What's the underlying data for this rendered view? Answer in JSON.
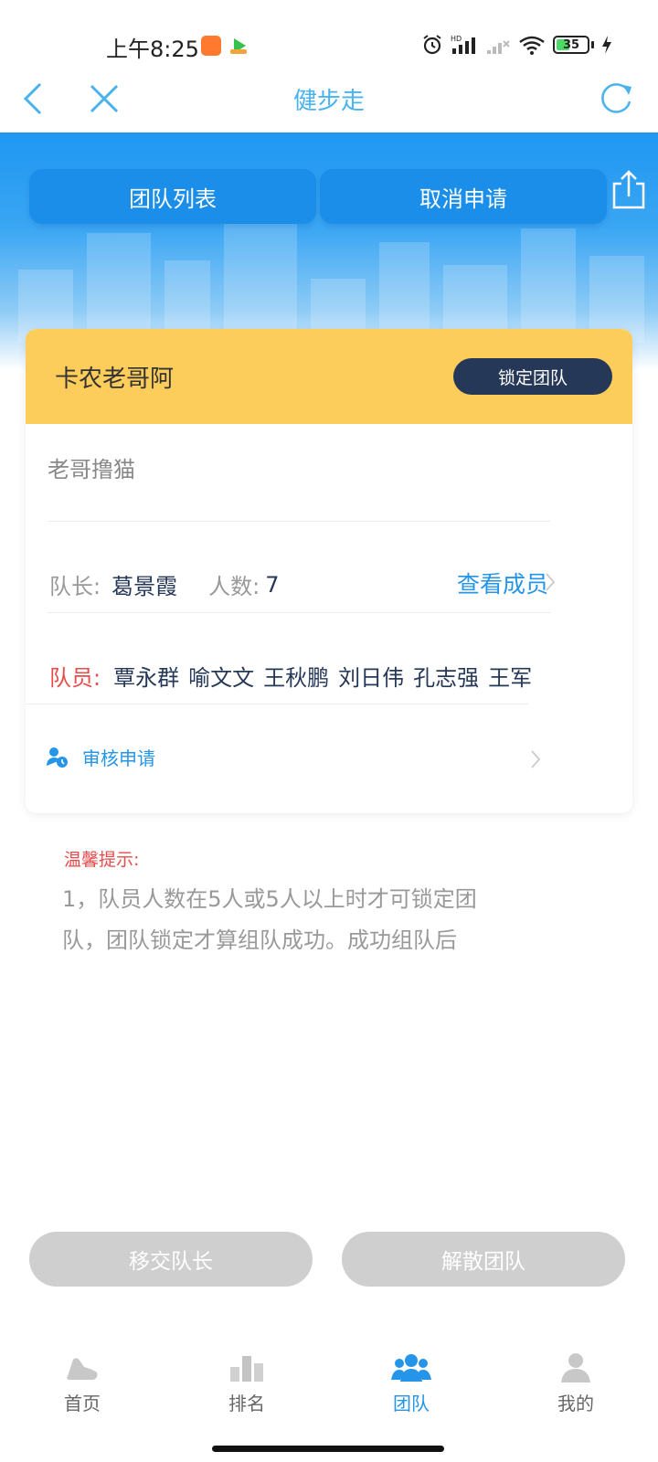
{
  "status_bar": {
    "time": "上午8:25",
    "battery": "35"
  },
  "nav": {
    "title": "健步走"
  },
  "hero": {
    "team_list_label": "团队列表",
    "cancel_apply_label": "取消申请"
  },
  "team": {
    "name": "卡农老哥阿",
    "lock_label": "锁定团队",
    "slogan": "老哥撸猫",
    "leader_label": "队长:",
    "leader_name": "葛景霞",
    "count_label": "人数:",
    "count_value": "7",
    "view_members_label": "查看成员",
    "members_label": "队员:",
    "members": [
      "覃永群",
      "喻文文",
      "王秋鹏",
      "刘日伟",
      "孔志强",
      "王军"
    ],
    "review_label": "审核申请"
  },
  "tips": {
    "title": "温馨提示:",
    "text": "1，队员人数在5人或5人以上时才可锁定团队，团队锁定才算组队成功。成功组队后"
  },
  "actions": {
    "transfer_label": "移交队长",
    "disband_label": "解散团队"
  },
  "tabs": [
    {
      "label": "首页",
      "icon": "shoe-icon"
    },
    {
      "label": "排名",
      "icon": "ranking-icon"
    },
    {
      "label": "团队",
      "icon": "team-icon"
    },
    {
      "label": "我的",
      "icon": "user-icon"
    }
  ],
  "colors": {
    "accent": "#2495e8",
    "card_header": "#fdcd5c",
    "lock_button": "#263858",
    "warning": "#e94b4b",
    "disabled_button": "#cfcfcf"
  }
}
